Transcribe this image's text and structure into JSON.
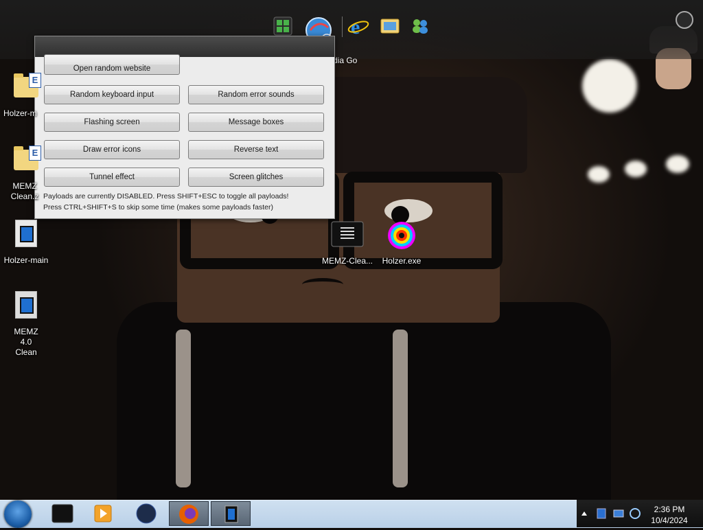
{
  "dock": {
    "items": [
      {
        "name": "Calculator-like app"
      },
      {
        "name": "Download Media Go"
      },
      {
        "name": "Internet Explorer"
      },
      {
        "name": "Windows Photo Viewer"
      },
      {
        "name": "Windows Live Messenger"
      }
    ],
    "hover_label": "Download Media Go"
  },
  "dialog": {
    "partial_button": "Open random website",
    "buttons": [
      "Random keyboard input",
      "Random error sounds",
      "Flashing screen",
      "Message boxes",
      "Draw error icons",
      "Reverse text",
      "Tunnel effect",
      "Screen glitches"
    ],
    "status_line1": "Payloads are currently DISABLED. Press SHIFT+ESC to toggle all payloads!",
    "status_line2": "Press CTRL+SHIFT+S to skip some time (makes some payloads faster)"
  },
  "desktop": {
    "icons": [
      {
        "label": "Holzer-m"
      },
      {
        "label": "MEMZ Clean.z"
      },
      {
        "label": "Holzer-main"
      },
      {
        "label": "MEMZ 4.0 Clean"
      },
      {
        "label": "MEMZ-Clea..."
      },
      {
        "label": "Holzer.exe"
      }
    ]
  },
  "taskbar": {
    "apps": [
      "Terminal",
      "Media Player",
      "Firefox",
      "Firefox",
      "MEMZ"
    ],
    "clock_time": "2:36 PM",
    "clock_date": "10/4/2024"
  },
  "colors": {
    "taskbar": "#c6daee",
    "dialog_bg": "#ececec",
    "accent_blue": "#1f6fd0"
  }
}
